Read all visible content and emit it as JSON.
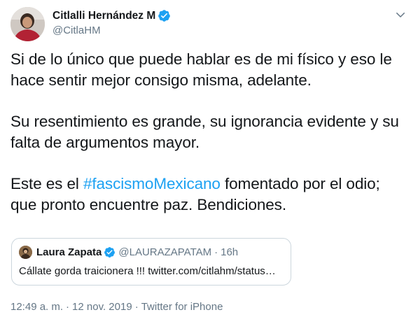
{
  "author": {
    "name": "Citlalli Hernández M",
    "handle": "@CitlaHM",
    "verified_icon": "verified-badge-icon",
    "avatar": "profile-photo"
  },
  "tweet": {
    "paragraphs": [
      "Si de lo único que puede hablar es de mi físico y eso le hace sentir mejor consigo misma, adelante.",
      "Su resentimiento es grande, su ignorancia evidente y su falta de argumentos mayor."
    ],
    "last_prefix": "Este es el ",
    "hashtag": "#fascismoMexicano",
    "last_suffix": " fomentado por el odio; que pronto encuentre paz. Bendiciones."
  },
  "quote": {
    "name": "Laura Zapata",
    "handle": "@LAURAZAPATAM",
    "dot": "·",
    "time": "16h",
    "text": "Cállate gorda traicionera !!! twitter.com/citlahm/status…"
  },
  "meta": {
    "time": "12:49 a. m.",
    "date": "12 nov. 2019",
    "separator": "·",
    "source": "Twitter for iPhone"
  },
  "colors": {
    "link": "#1da1f2",
    "secondary_text": "#657786",
    "border": "#ccd6dd"
  }
}
